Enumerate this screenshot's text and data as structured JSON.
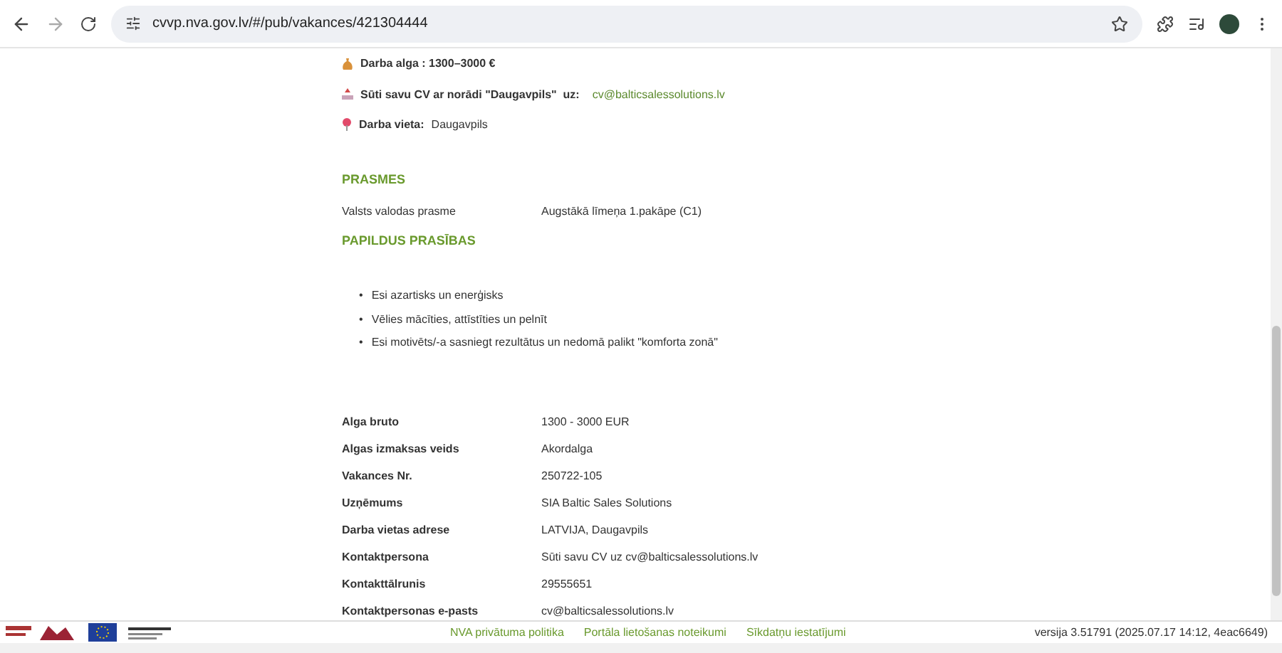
{
  "browser": {
    "url": "cvvp.nva.gov.lv/#/pub/vakances/421304444"
  },
  "intro": [
    {
      "kind": "salary",
      "label": "Darba alga : 1300–3000 €"
    },
    {
      "kind": "send",
      "label": "Sūti savu CV ar norādi \"Daugavpils\"  uz:",
      "value": "cv@balticsalessolutions.lv"
    },
    {
      "kind": "place",
      "label": "Darba vieta:",
      "value": "Daugavpils"
    }
  ],
  "skills": {
    "title": "PRASMES",
    "rows": [
      {
        "label": "Valsts valodas prasme",
        "value": "Augstākā līmeņa 1.pakāpe (C1)"
      }
    ]
  },
  "extra": {
    "title": "PAPILDUS PRASĪBAS",
    "items": [
      {
        "bullet": "•",
        "text": "Esi azartisks un enerģisks"
      },
      {
        "bullet": "•",
        "text": "Vēlies mācīties, attīstīties un pelnīt"
      },
      {
        "bullet": "•",
        "text": "Esi motivēts/-a sasniegt rezultātus un nedomā palikt \"komforta zonā\""
      }
    ]
  },
  "details": [
    {
      "label": "Alga bruto",
      "value": "1300 - 3000 EUR"
    },
    {
      "label": "Algas izmaksas veids",
      "value": "Akordalga"
    },
    {
      "label": "Vakances Nr.",
      "value": "250722-105"
    },
    {
      "label": "Uzņēmums",
      "value": "SIA Baltic Sales Solutions"
    },
    {
      "label": "Darba vietas adrese",
      "value": "LATVIJA, Daugavpils"
    },
    {
      "label": "Kontaktpersona",
      "value": "Sūti savu CV uz cv@balticsalessolutions.lv"
    },
    {
      "label": "Kontakttālrunis",
      "value": "29555651"
    },
    {
      "label": "Kontaktpersonas e-pasts",
      "value": "cv@balticsalessolutions.lv"
    }
  ],
  "footer": {
    "links": [
      "NVA privātuma politika",
      "Portāla lietošanas noteikumi",
      "Sīkdatņu iestatījumi"
    ],
    "version": "versija 3.51791 (2025.07.17 14:12, 4eac6649)"
  }
}
